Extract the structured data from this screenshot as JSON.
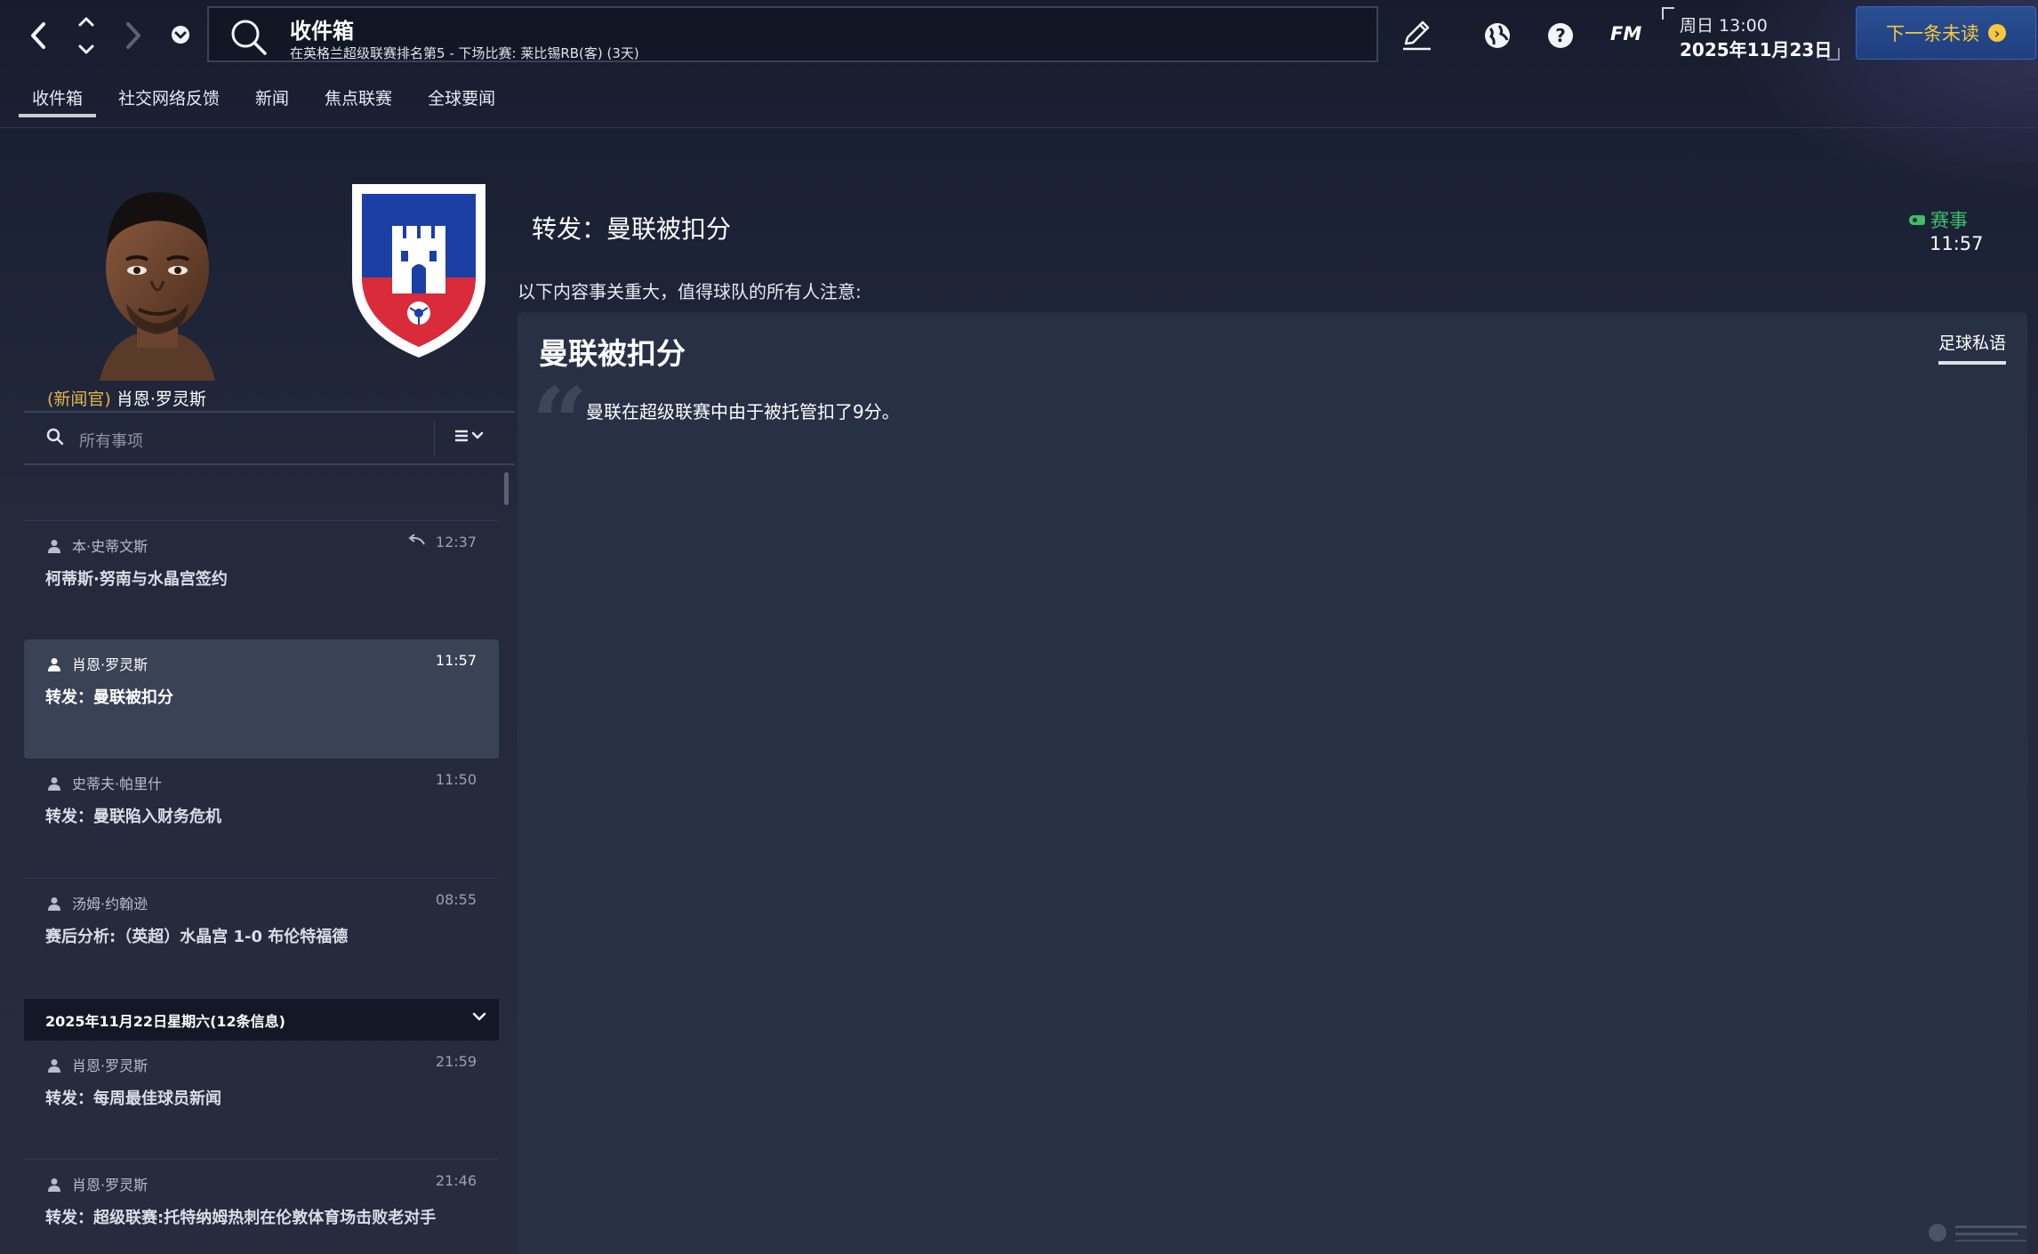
{
  "topbar": {
    "title": "收件箱",
    "subtitle": "在英格兰超级联赛排名第5 - 下场比赛: 莱比锡RB(客) (3天)",
    "fm_label": "FM",
    "day_time": "周日 13:00",
    "date": "2025年11月23日",
    "next_unread_label": "下一条未读"
  },
  "tabs": [
    {
      "label": "收件箱",
      "active": true
    },
    {
      "label": "社交网络反馈",
      "active": false
    },
    {
      "label": "新闻",
      "active": false
    },
    {
      "label": "焦点联赛",
      "active": false
    },
    {
      "label": "全球要闻",
      "active": false
    }
  ],
  "sender": {
    "role": "(新闻官)",
    "name": "肖恩·罗灵斯"
  },
  "filter": {
    "placeholder": "所有事项"
  },
  "messages": [
    {
      "sender": "本·史蒂文斯",
      "time": "12:37",
      "subject": "柯蒂斯·努南与水晶宫签约",
      "replied": true
    },
    {
      "sender": "肖恩·罗灵斯",
      "time": "11:57",
      "subject": "转发：曼联被扣分",
      "selected": true
    },
    {
      "sender": "史蒂夫·帕里什",
      "time": "11:50",
      "subject": "转发：曼联陷入财务危机"
    },
    {
      "sender": "汤姆·约翰逊",
      "time": "08:55",
      "subject": "赛后分析:（英超）水晶宫 1-0 布伦特福德"
    }
  ],
  "day_group": {
    "label": "2025年11月22日星期六(12条信息)"
  },
  "messages_prev_day": [
    {
      "sender": "肖恩·罗灵斯",
      "time": "21:59",
      "subject": "转发：每周最佳球员新闻"
    },
    {
      "sender": "肖恩·罗灵斯",
      "time": "21:46",
      "subject": "转发：超级联赛:托特纳姆热刺在伦敦体育场击败老对手"
    }
  ],
  "detail": {
    "title": "转发：曼联被扣分",
    "category": "赛事",
    "time": "11:57",
    "intro": "以下内容事关重大，值得球队的所有人注意:",
    "card_title": "曼联被扣分",
    "card_source": "足球私语",
    "card_body": "曼联在超级联赛中由于被托管扣了9分。"
  },
  "colors": {
    "accent_yellow": "#f6c83c",
    "button_blue": "#2a4e93",
    "category_green": "#3fbf6b",
    "role_gold": "#e0b44a"
  }
}
